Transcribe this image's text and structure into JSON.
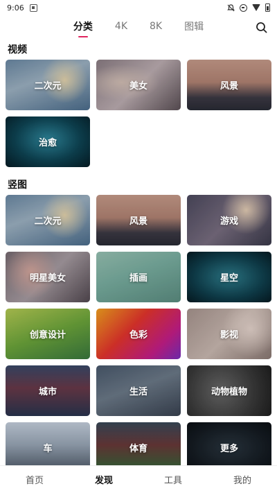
{
  "status_bar": {
    "time": "9:06",
    "icons": [
      "notification-icon",
      "bell-off-icon",
      "do-not-disturb-icon",
      "wifi-icon",
      "battery-icon"
    ]
  },
  "tabs": {
    "items": [
      {
        "label": "分类",
        "active": true
      },
      {
        "label": "4K",
        "active": false
      },
      {
        "label": "8K",
        "active": false
      },
      {
        "label": "图辑",
        "active": false
      }
    ],
    "accent_color": "#e0245e",
    "search_icon": "search-icon"
  },
  "sections": {
    "video": {
      "title": "视频",
      "tiles": [
        {
          "label": "二次元"
        },
        {
          "label": "美女"
        },
        {
          "label": "风景"
        },
        {
          "label": "治愈"
        }
      ]
    },
    "vertical": {
      "title": "竖图",
      "tiles": [
        {
          "label": "二次元"
        },
        {
          "label": "风景"
        },
        {
          "label": "游戏"
        },
        {
          "label": "明星美女"
        },
        {
          "label": "插画"
        },
        {
          "label": "星空"
        },
        {
          "label": "创意设计"
        },
        {
          "label": "色彩"
        },
        {
          "label": "影视"
        },
        {
          "label": "城市"
        },
        {
          "label": "生活"
        },
        {
          "label": "动物植物"
        },
        {
          "label": "车"
        },
        {
          "label": "体育"
        },
        {
          "label": "更多"
        }
      ]
    }
  },
  "bottom_nav": {
    "items": [
      {
        "label": "首页",
        "active": false
      },
      {
        "label": "发现",
        "active": true
      },
      {
        "label": "工具",
        "active": false
      },
      {
        "label": "我的",
        "active": false
      }
    ]
  }
}
